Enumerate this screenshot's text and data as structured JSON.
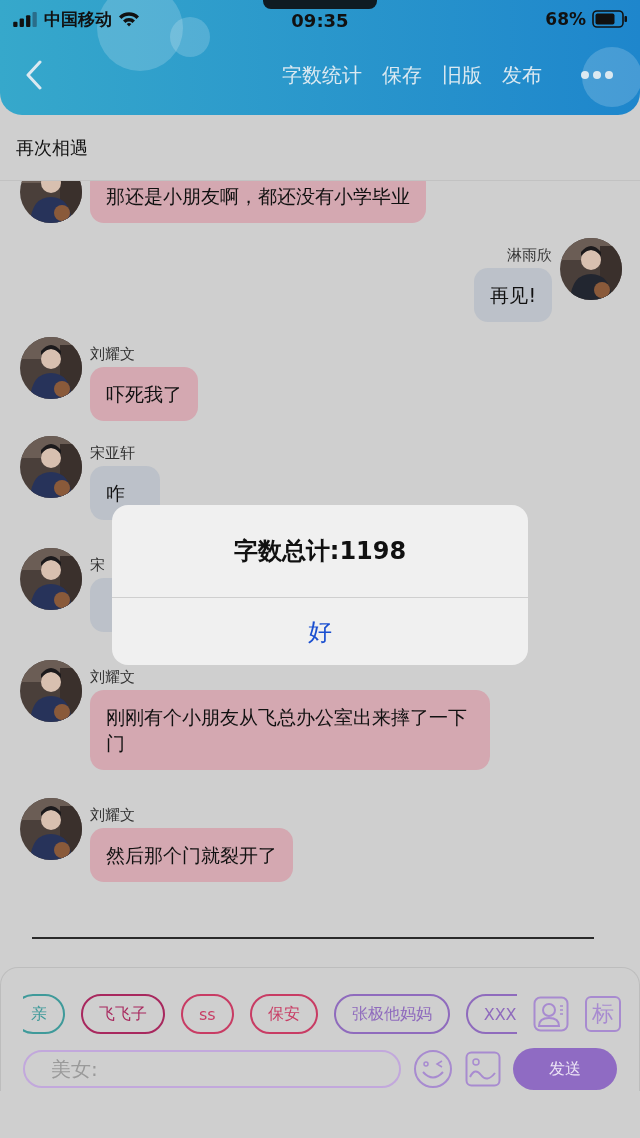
{
  "status_bar": {
    "carrier": "中国移动",
    "time": "09:35",
    "battery": "68%"
  },
  "header": {
    "actions": [
      "字数统计",
      "保存",
      "旧版",
      "发布"
    ]
  },
  "title": "再次相遇",
  "messages": [
    {
      "kind": "incoming",
      "text": "那还是小朋友啊，都还没有小学毕业",
      "color": "#d4a8b1"
    },
    {
      "kind": "outgoing",
      "sender": "淋雨欣",
      "text": "再见!",
      "color": "#bcc1c9"
    },
    {
      "kind": "incoming",
      "sender": "刘耀文",
      "text": "吓死我了",
      "color": "#d4a8b1"
    },
    {
      "kind": "incoming",
      "sender": "宋亚轩",
      "text": "咋",
      "color": "#bcc1c9"
    },
    {
      "kind": "incoming",
      "sender": "宋",
      "color": "#bcc1c9"
    },
    {
      "kind": "incoming",
      "sender": "刘耀文",
      "text": "刚刚有个小朋友从飞总办公室出来摔了一下门",
      "color": "#d4a8b1"
    },
    {
      "kind": "incoming",
      "sender": "刘耀文",
      "text": "然后那个门就裂开了",
      "color": "#d4a8b1"
    }
  ],
  "alert": {
    "title": "字数总计:1198",
    "button": "好"
  },
  "quick_tags": [
    {
      "label": "亲",
      "color": "#3f9a9a"
    },
    {
      "label": "飞飞子",
      "color": "#a8285e"
    },
    {
      "label": "ss",
      "color": "#c83c64"
    },
    {
      "label": "保安",
      "color": "#c83c64"
    },
    {
      "label": "张极他妈妈",
      "color": "#8f6bbd"
    },
    {
      "label": "XXX",
      "color": "#8f6bbd"
    }
  ],
  "tag_button": "标",
  "composer": {
    "placeholder": "美女:",
    "send": "发送"
  }
}
